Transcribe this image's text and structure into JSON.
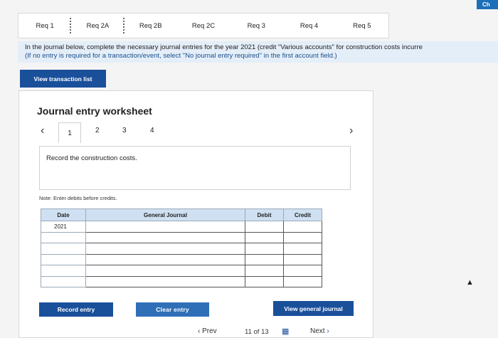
{
  "tabs": [
    "Req 1",
    "Req 2A",
    "Req 2B",
    "Req 2C",
    "Req 3",
    "Req 4",
    "Req 5"
  ],
  "corner_button": "Ch",
  "instructions": {
    "line1": "In the journal below, complete the necessary journal entries for the year 2021 (credit \"Various accounts\" for construction costs incurre",
    "line2": "(If no entry is required for a transaction/event, select \"No journal entry required\" in the first account field.)"
  },
  "view_transaction_list": "View transaction list",
  "worksheet": {
    "title": "Journal entry worksheet",
    "pages": [
      "1",
      "2",
      "3",
      "4"
    ],
    "active_page": "1",
    "record_text": "Record the construction costs.",
    "note": "Note: Enter debits before credits.",
    "columns": {
      "date": "Date",
      "journal": "General Journal",
      "debit": "Debit",
      "credit": "Credit"
    },
    "rows": [
      {
        "date": "2021"
      },
      {
        "date": ""
      },
      {
        "date": ""
      },
      {
        "date": ""
      },
      {
        "date": ""
      },
      {
        "date": ""
      }
    ],
    "record_entry": "Record entry",
    "clear_entry": "Clear entry",
    "view_general_journal": "View general journal"
  },
  "footer": {
    "prev": "Prev",
    "position": "11 of 13",
    "next": "Next"
  },
  "icons": {
    "left": "chevron-left-icon",
    "right": "chevron-right-icon",
    "grid": "grid-icon"
  }
}
